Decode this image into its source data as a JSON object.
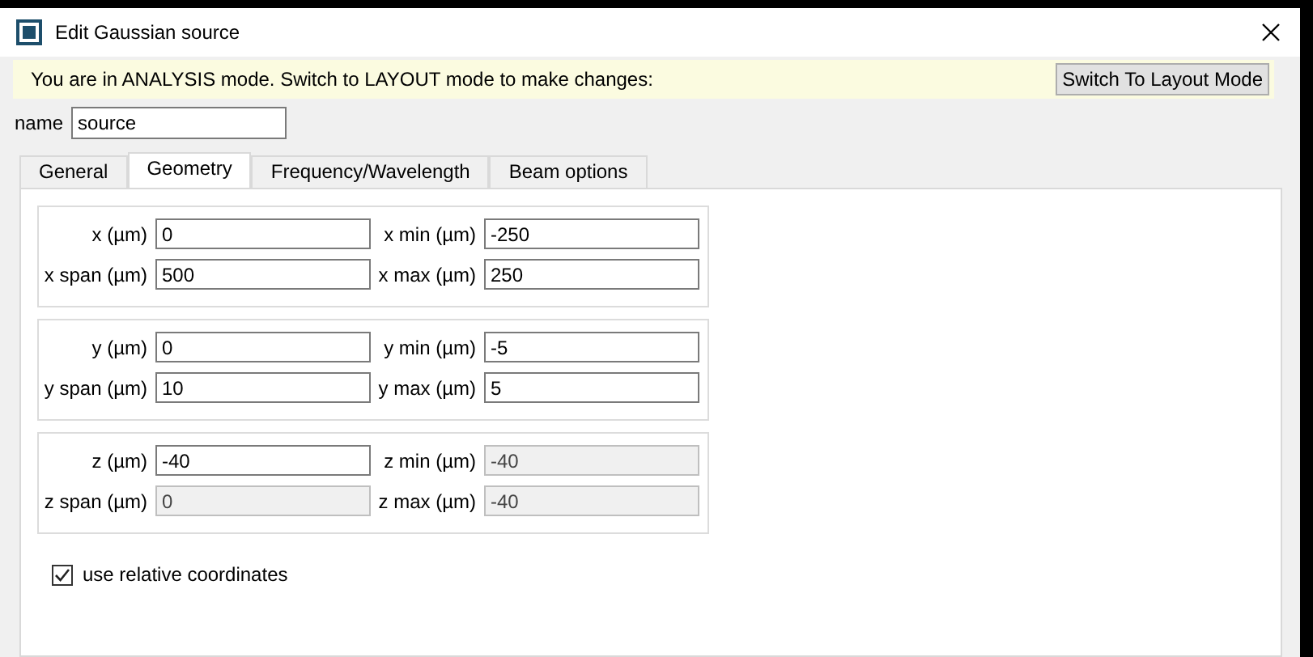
{
  "window": {
    "title": "Edit Gaussian source"
  },
  "banner": {
    "message": "You are in ANALYSIS mode.  Switch to LAYOUT mode to make changes:",
    "button": "Switch To Layout Mode"
  },
  "name_field": {
    "label": "name",
    "value": "source"
  },
  "tabs": [
    {
      "label": "General",
      "selected": false
    },
    {
      "label": "Geometry",
      "selected": true
    },
    {
      "label": "Frequency/Wavelength",
      "selected": false
    },
    {
      "label": "Beam options",
      "selected": false
    }
  ],
  "groups": [
    {
      "rows": [
        [
          {
            "label": "x (µm)",
            "value": "0",
            "disabled": false
          },
          {
            "label": "x min (µm)",
            "value": "-250",
            "disabled": false
          }
        ],
        [
          {
            "label": "x span (µm)",
            "value": "500",
            "disabled": false
          },
          {
            "label": "x max (µm)",
            "value": "250",
            "disabled": false
          }
        ]
      ]
    },
    {
      "rows": [
        [
          {
            "label": "y (µm)",
            "value": "0",
            "disabled": false
          },
          {
            "label": "y min (µm)",
            "value": "-5",
            "disabled": false
          }
        ],
        [
          {
            "label": "y span (µm)",
            "value": "10",
            "disabled": false
          },
          {
            "label": "y max (µm)",
            "value": "5",
            "disabled": false
          }
        ]
      ]
    },
    {
      "rows": [
        [
          {
            "label": "z (µm)",
            "value": "-40",
            "disabled": false
          },
          {
            "label": "z min (µm)",
            "value": "-40",
            "disabled": true
          }
        ],
        [
          {
            "label": "z span (µm)",
            "value": "0",
            "disabled": true
          },
          {
            "label": "z max (µm)",
            "value": "-40",
            "disabled": true
          }
        ]
      ]
    }
  ],
  "relative": {
    "label": "use relative coordinates",
    "checked": true
  }
}
